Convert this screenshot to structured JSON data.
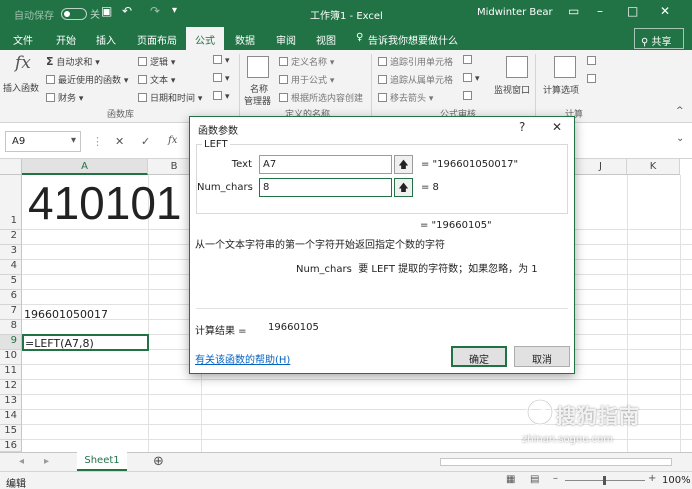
{
  "titlebar": {
    "autosave": "自动保存",
    "toggle_state": "关",
    "doc_title": "工作簿1 - Excel",
    "user": "Midwinter Bear",
    "accent": "#217346"
  },
  "tabs": [
    "文件",
    "开始",
    "插入",
    "页面布局",
    "公式",
    "数据",
    "审阅",
    "视图"
  ],
  "active_tab": "公式",
  "tell_me": "告诉我你想要做什么",
  "share": "共享",
  "ribbon": {
    "insert_function": "插入函数",
    "autosum": "自动求和",
    "recent": "最近使用的函数",
    "financial": "财务",
    "logical": "逻辑",
    "text": "文本",
    "datetime": "日期和时间",
    "group_function_library": "函数库",
    "name_manager_1": "名称",
    "name_manager_2": "管理器",
    "define_name": "定义名称",
    "use_in_formula": "用于公式",
    "create_from_selection": "根据所选内容创建",
    "group_defined_names": "定义的名称",
    "trace_precedents": "追踪引用单元格",
    "trace_dependents": "追踪从属单元格",
    "remove_arrows": "移去箭头",
    "group_formula_auditing": "公式审核",
    "watch_window": "监视窗口",
    "calc_options": "计算选项",
    "group_calculation": "计算"
  },
  "formula_bar": {
    "name_box": "A9",
    "cancel": "✕",
    "enter": "✓",
    "fx": "fx"
  },
  "grid": {
    "columns": [
      "A",
      "B",
      "J",
      "K"
    ],
    "rows": [
      "1",
      "2",
      "3",
      "4",
      "5",
      "6",
      "7",
      "8",
      "9",
      "10",
      "11",
      "12",
      "13",
      "14",
      "15",
      "16"
    ],
    "a1": "410101",
    "a7": "196601050017",
    "a9": "=LEFT(A7,8)"
  },
  "sheet_tab": "Sheet1",
  "add_sheet": "⊕",
  "status": {
    "mode": "编辑",
    "zoom": "100%"
  },
  "dialog": {
    "title": "函数参数",
    "help_glyph": "?",
    "close_glyph": "✕",
    "func_name": "LEFT",
    "text_label": "Text",
    "text_value": "A7",
    "text_result": "= \"196601050017\"",
    "num_label": "Num_chars",
    "num_value": "8",
    "num_result": "= 8",
    "overall_result": "= \"19660105\"",
    "description": "从一个文本字符串的第一个字符开始返回指定个数的字符",
    "arg_description": "Num_chars  要 LEFT 提取的字符数；如果忽略，为 1",
    "calc_result_label": "计算结果 =",
    "calc_result_value": "19660105",
    "help_link": "有关该函数的帮助(H)",
    "ok": "确定",
    "cancel": "取消"
  },
  "watermark": {
    "text": "搜狗指南",
    "url": "zhinan.sogou.com"
  }
}
